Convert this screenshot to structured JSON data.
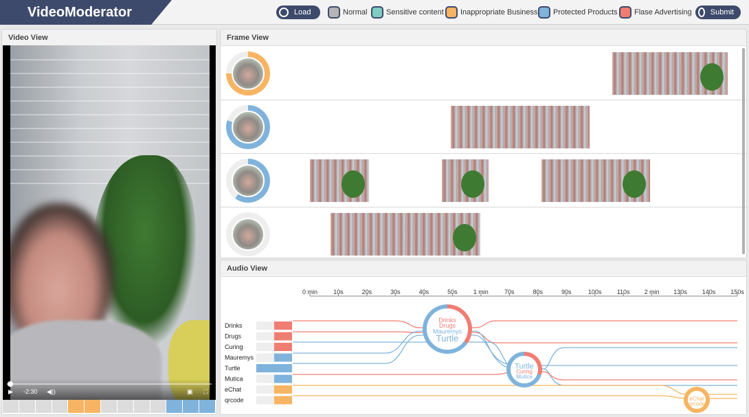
{
  "app": {
    "title": "VideoModerator"
  },
  "header": {
    "load_label": "Load",
    "submit_label": "Submit",
    "legend": [
      {
        "label": "Normal",
        "color": "#b5b5b5"
      },
      {
        "label": "Sensitive content",
        "color": "#7ecdc0"
      },
      {
        "label": "Inappropriate Business",
        "color": "#f7b462"
      },
      {
        "label": "Protected Products",
        "color": "#7fb3dc"
      },
      {
        "label": "Flase Advertising",
        "color": "#f07d72"
      }
    ]
  },
  "video_view": {
    "title": "Video View",
    "time": "-2:30",
    "play_icon": "play-icon",
    "volume_icon": "volume-icon",
    "pip_icon": "pip-icon",
    "fullscreen_icon": "fullscreen-icon",
    "playback_fraction": 0.01,
    "timeline": [
      "normal",
      "normal",
      "normal",
      "normal",
      "inappropriate",
      "inappropriate",
      "normal",
      "normal",
      "normal",
      "normal",
      "protected",
      "protected",
      "protected"
    ]
  },
  "frame_view": {
    "title": "Frame View",
    "rows": [
      {
        "category": "inappropriate",
        "ring_color": "#f7b462",
        "ring_fraction": 0.75
      },
      {
        "category": "protected",
        "ring_color": "#7fb3dc",
        "ring_fraction": 0.8
      },
      {
        "category": "protected",
        "ring_color": "#7fb3dc",
        "ring_fraction": 0.6
      },
      {
        "category": "normal",
        "ring_color": "#dcdcdc",
        "ring_fraction": 0
      }
    ]
  },
  "audio_view": {
    "title": "Audio View",
    "axis_ticks": [
      "0 min",
      "10s",
      "20s",
      "30s",
      "40s",
      "50s",
      "1 min",
      "70s",
      "80s",
      "90s",
      "100s",
      "110s",
      "2 min",
      "130s",
      "140s",
      "150s"
    ],
    "keywords": [
      {
        "label": "Drinks",
        "color": "#f07d72"
      },
      {
        "label": "Drugs",
        "color": "#f07d72"
      },
      {
        "label": "Curing",
        "color": "#f07d72"
      },
      {
        "label": "Mauremys",
        "color": "#7fb3dc"
      },
      {
        "label": "Turtle",
        "color": "#7fb3dc"
      },
      {
        "label": "Mutica",
        "color": "#7fb3dc"
      },
      {
        "label": "eChat",
        "color": "#f7b462"
      },
      {
        "label": "qrcode",
        "color": "#f7b462"
      }
    ],
    "clusters": [
      {
        "words": [
          "Drinks",
          "Drugs",
          "Mauremys",
          "Turtle"
        ]
      },
      {
        "words": [
          "Turtle",
          "Curing",
          "Mutica"
        ]
      },
      {
        "words": [
          "eChat",
          "qrcode"
        ]
      }
    ]
  },
  "colors": {
    "normal": "#dcdcdc",
    "inappropriate": "#f7b462",
    "protected": "#7fb3dc",
    "false_ad": "#f07d72",
    "navy": "#3d4a6b"
  }
}
